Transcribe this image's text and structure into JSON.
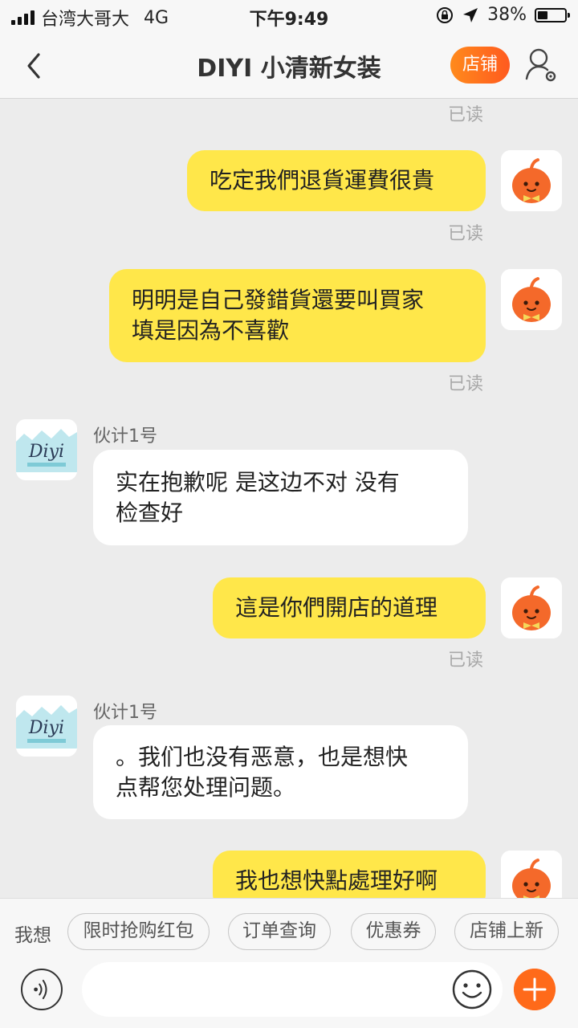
{
  "status_bar": {
    "carrier": "台湾大哥大",
    "network": "4G",
    "time": "下午9:49",
    "battery": "38%",
    "battery_level": 0.38
  },
  "nav": {
    "title": "DIYI 小清新女装",
    "store_label": "店铺"
  },
  "chat": {
    "read_label": "已读",
    "messages": [
      {
        "from": "me",
        "text": "吃定我們退貨運費很貴",
        "status": "已读"
      },
      {
        "from": "me",
        "text": "明明是自己發錯貨還要叫買家\n填是因為不喜歡",
        "status": "已读"
      },
      {
        "from": "shop",
        "sender": "伙计1号",
        "text": "实在抱歉呢 是这边不对 没有\n检查好"
      },
      {
        "from": "me",
        "text": "這是你們開店的道理",
        "status": "已读"
      },
      {
        "from": "shop",
        "sender": "伙计1号",
        "text": "。我们也没有恶意，也是想快\n点帮您处理问题。"
      },
      {
        "from": "me",
        "text": "我也想快點處理好啊"
      }
    ],
    "shop_avatar_text": "Diyi"
  },
  "quick_replies": {
    "label": "我想",
    "items": [
      "限时抢购红包",
      "订单查询",
      "优惠券",
      "店铺上新"
    ]
  },
  "input": {
    "value": "",
    "placeholder": ""
  },
  "colors": {
    "my_bubble": "#ffe74a",
    "their_bubble": "#ffffff",
    "accent": "#ff6a1a",
    "background": "#ececec"
  }
}
